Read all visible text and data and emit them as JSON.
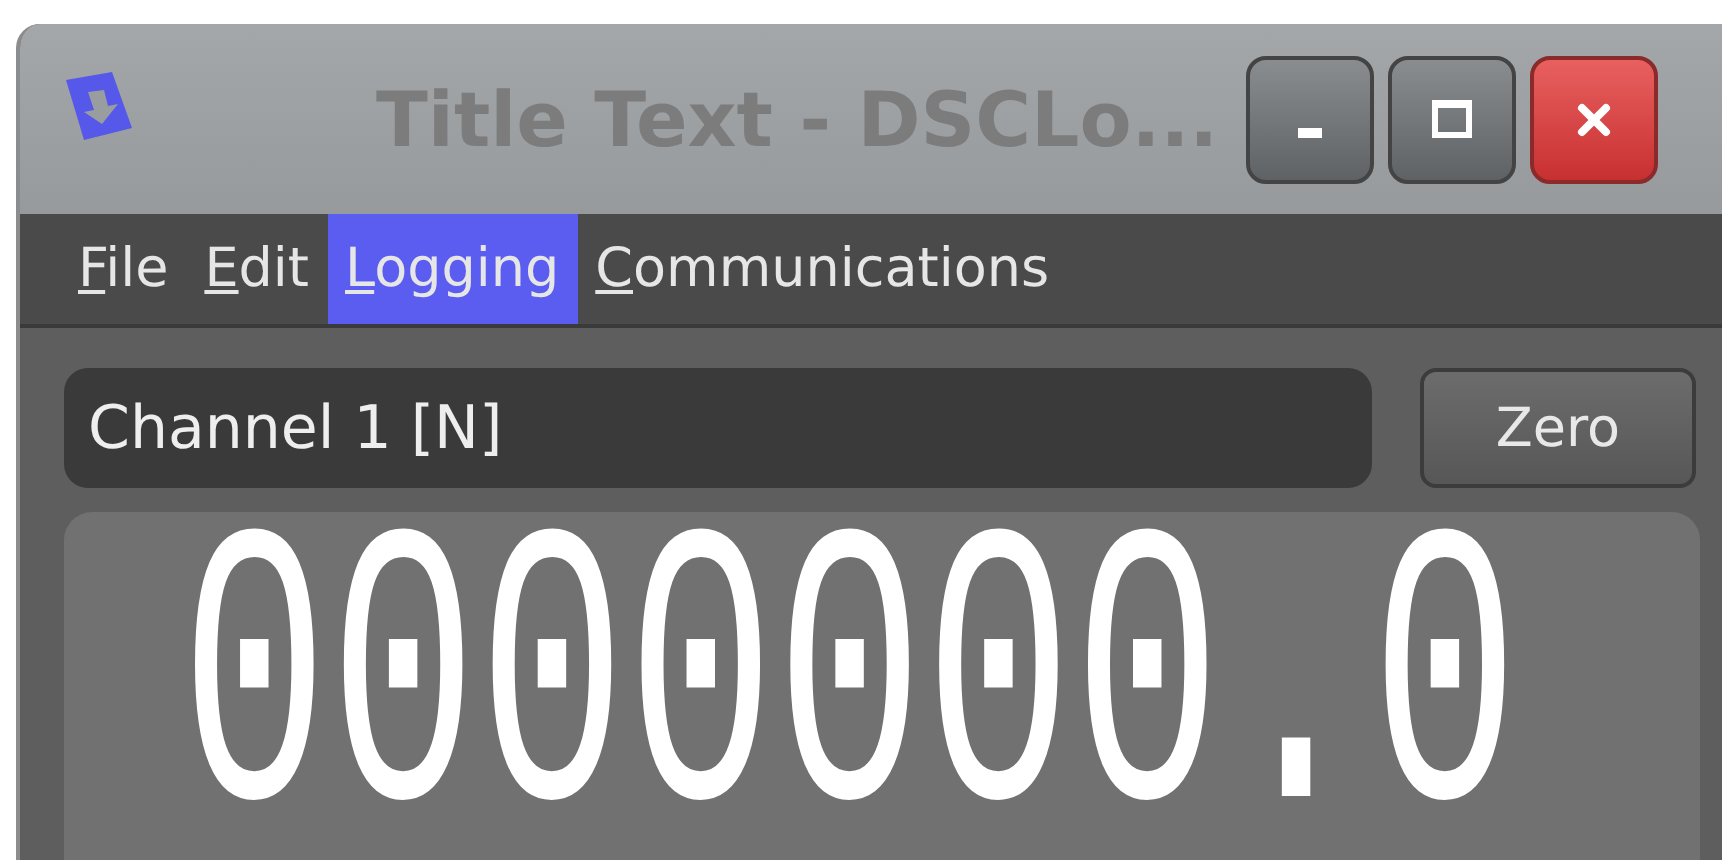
{
  "window": {
    "title": "Title Text - DSCLo..."
  },
  "menu": [
    {
      "label": "File",
      "selected": false
    },
    {
      "label": "Edit",
      "selected": false
    },
    {
      "label": "Logging",
      "selected": true
    },
    {
      "label": "Communications",
      "selected": false
    }
  ],
  "channel": {
    "value": "Channel 1 [N]"
  },
  "zero_button": "Zero",
  "display": {
    "reading": "0000000.0"
  }
}
